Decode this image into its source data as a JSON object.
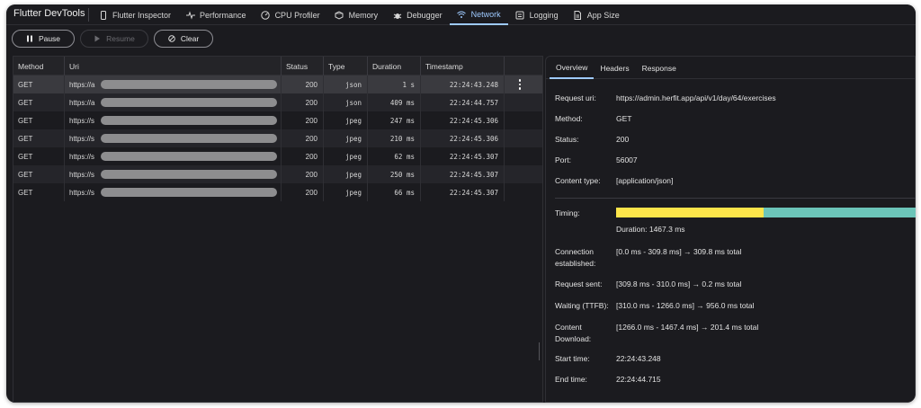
{
  "app": {
    "title": "Flutter DevTools"
  },
  "nav": {
    "tabs": [
      {
        "label": "Flutter Inspector",
        "icon": "phone-icon"
      },
      {
        "label": "Performance",
        "icon": "pulse-icon"
      },
      {
        "label": "CPU Profiler",
        "icon": "gauge-icon"
      },
      {
        "label": "Memory",
        "icon": "memory-icon"
      },
      {
        "label": "Debugger",
        "icon": "bug-icon"
      },
      {
        "label": "Network",
        "icon": "wifi-icon",
        "active": true
      },
      {
        "label": "Logging",
        "icon": "logging-icon"
      },
      {
        "label": "App Size",
        "icon": "file-icon"
      }
    ]
  },
  "toolbar": {
    "pause_label": "Pause",
    "resume_label": "Resume",
    "clear_label": "Clear"
  },
  "table": {
    "headers": {
      "method": "Method",
      "uri": "Uri",
      "status": "Status",
      "type": "Type",
      "duration": "Duration",
      "timestamp": "Timestamp"
    },
    "rows": [
      {
        "method": "GET",
        "uri": "https://a",
        "status": "200",
        "type": "json",
        "duration": "1 s",
        "timestamp": "22:24:43.248",
        "selected": true
      },
      {
        "method": "GET",
        "uri": "https://a",
        "status": "200",
        "type": "json",
        "duration": "409 ms",
        "timestamp": "22:24:44.757"
      },
      {
        "method": "GET",
        "uri": "https://s",
        "status": "200",
        "type": "jpeg",
        "duration": "247 ms",
        "timestamp": "22:24:45.306"
      },
      {
        "method": "GET",
        "uri": "https://s",
        "status": "200",
        "type": "jpeg",
        "duration": "210 ms",
        "timestamp": "22:24:45.306"
      },
      {
        "method": "GET",
        "uri": "https://s",
        "status": "200",
        "type": "jpeg",
        "duration": "62 ms",
        "timestamp": "22:24:45.307"
      },
      {
        "method": "GET",
        "uri": "https://s",
        "status": "200",
        "type": "jpeg",
        "duration": "250 ms",
        "timestamp": "22:24:45.307"
      },
      {
        "method": "GET",
        "uri": "https://s",
        "status": "200",
        "type": "jpeg",
        "duration": "66 ms",
        "timestamp": "22:24:45.307"
      }
    ]
  },
  "detail": {
    "tabs": [
      "Overview",
      "Headers",
      "Response"
    ],
    "active_tab": "Overview",
    "request_url": {
      "label": "Request uri:",
      "value": "https://admin.herfit.app/api/v1/day/64/exercises"
    },
    "method": {
      "label": "Method:",
      "value": "GET"
    },
    "status": {
      "label": "Status:",
      "value": "200"
    },
    "port": {
      "label": "Port:",
      "value": "56007"
    },
    "content_type": {
      "label": "Content type:",
      "value": "[application/json]"
    },
    "timing": {
      "label": "Timing:",
      "duration": "Duration: 1467.3 ms",
      "colors": {
        "connection": "#fde54a",
        "download": "#6cc5b9"
      }
    },
    "connection": {
      "label1": "Connection",
      "label2": "established:",
      "value": "[0.0 ms - 309.8 ms] → 309.8 ms total"
    },
    "request_sent": {
      "label": "Request sent:",
      "value": "[309.8 ms - 310.0 ms] → 0.2 ms total"
    },
    "waiting": {
      "label": "Waiting (TTFB):",
      "value": "[310.0 ms - 1266.0 ms] → 956.0 ms total"
    },
    "download": {
      "label1": "Content",
      "label2": "Download:",
      "value": "[1266.0 ms - 1467.4 ms] → 201.4 ms total"
    },
    "start_time": {
      "label": "Start time:",
      "value": "22:24:43.248"
    },
    "end_time": {
      "label": "End time:",
      "value": "22:24:44.715"
    }
  }
}
